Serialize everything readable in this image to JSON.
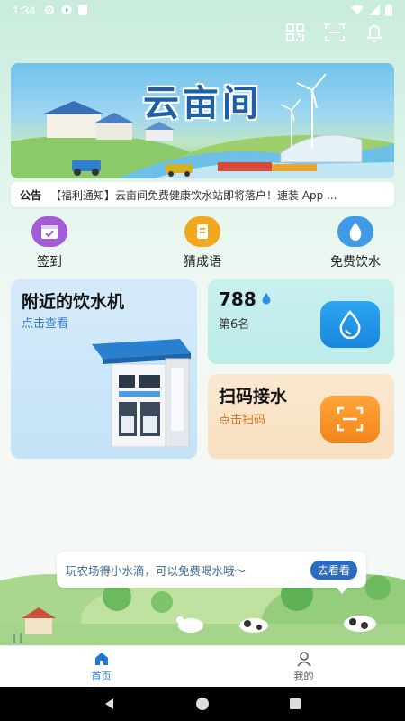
{
  "status_bar": {
    "time": "1:34"
  },
  "banner": {
    "title": "云亩间"
  },
  "notice": {
    "tag": "公告",
    "message": "【福利通知】云亩间免费健康饮水站即将落户！速装 App ..."
  },
  "quick_actions": [
    {
      "label": "签到",
      "icon": "calendar-check-icon",
      "color": "#a45bd8"
    },
    {
      "label": "猜成语",
      "icon": "book-icon",
      "color": "#f2a81e"
    },
    {
      "label": "免费饮水",
      "icon": "water-drop-icon",
      "color": "#3f9be8"
    }
  ],
  "cards": {
    "nearby": {
      "title": "附近的饮水机",
      "subtitle": "点击查看"
    },
    "score": {
      "value": "788",
      "rank": "第6名"
    },
    "scan": {
      "title": "扫码接水",
      "subtitle": "点击扫码"
    }
  },
  "promo": {
    "text": "玩农场得小水滴，可以免费喝水哦～",
    "button": "去看看"
  },
  "tabs": [
    {
      "label": "首页",
      "active": true
    },
    {
      "label": "我的",
      "active": false
    }
  ],
  "colors": {
    "primary": "#1f78d1",
    "scan_orange": "#f2861a",
    "water_blue": "#1786dd"
  }
}
